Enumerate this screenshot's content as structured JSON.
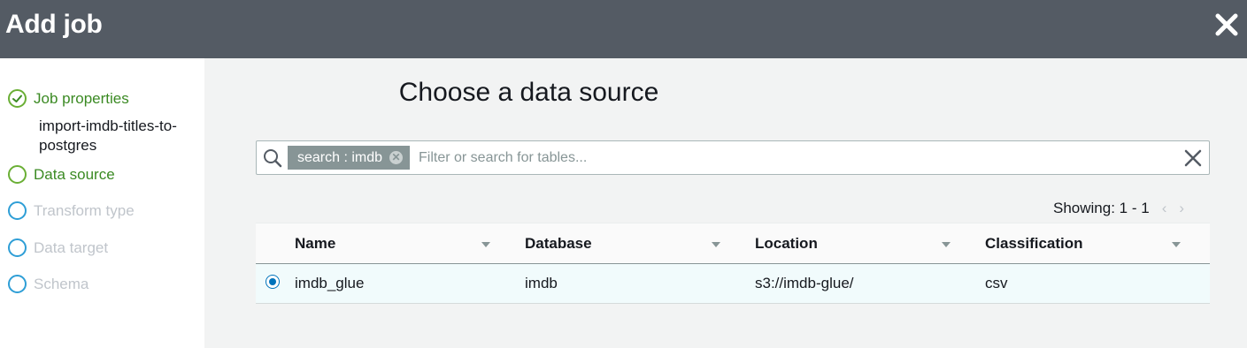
{
  "header": {
    "title": "Add job",
    "close_icon": "close-icon"
  },
  "sidebar": {
    "steps": [
      {
        "label": "Job properties",
        "state": "done",
        "icon": "check-circle-icon",
        "sub": "import-imdb-titles-to-postgres"
      },
      {
        "label": "Data source",
        "state": "active",
        "icon": "circle-icon"
      },
      {
        "label": "Transform type",
        "state": "pending",
        "icon": "circle-icon"
      },
      {
        "label": "Data target",
        "state": "pending",
        "icon": "circle-icon"
      },
      {
        "label": "Schema",
        "state": "pending",
        "icon": "circle-icon"
      }
    ]
  },
  "main": {
    "title": "Choose a data source",
    "search": {
      "token": "search : imdb",
      "placeholder": "Filter or search for tables...",
      "value": ""
    },
    "pager": {
      "text": "Showing: 1 - 1",
      "prev": "‹",
      "next": "›"
    },
    "table": {
      "columns": [
        "Name",
        "Database",
        "Location",
        "Classification"
      ],
      "rows": [
        {
          "selected": true,
          "cells": [
            "imdb_glue",
            "imdb",
            "s3://imdb-glue/",
            "csv"
          ]
        }
      ]
    }
  },
  "colors": {
    "header_bg": "#545b64",
    "success_green": "#3b8a23",
    "pending_blue": "#2e9ed6",
    "selected_row_bg": "#f1fbfc",
    "token_bg": "#879596"
  }
}
